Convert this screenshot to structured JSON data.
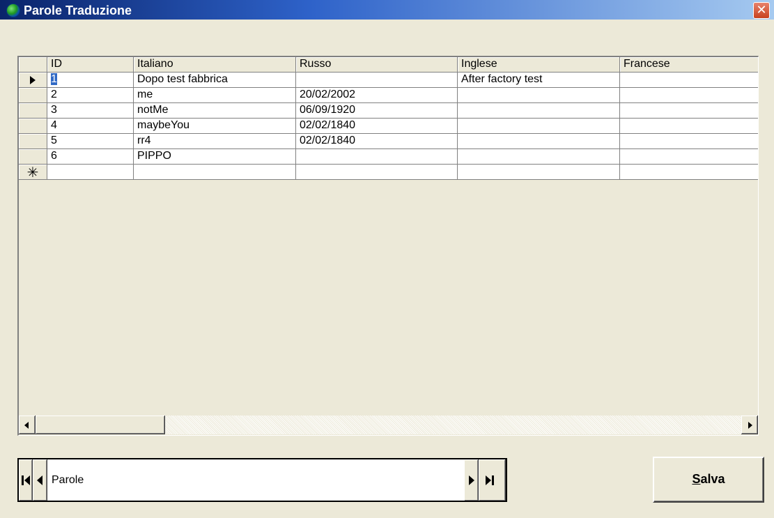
{
  "window": {
    "title": "Parole Traduzione",
    "close_glyph": "✕",
    "icon": "globe-icon"
  },
  "grid": {
    "columns": [
      "ID",
      "Italiano",
      "Russo",
      "Inglese",
      "Francese"
    ],
    "rows": [
      {
        "id": "1",
        "italiano": "Dopo test fabbrica",
        "russo": "",
        "inglese": "After factory test",
        "francese": ""
      },
      {
        "id": "2",
        "italiano": "me",
        "russo": "20/02/2002",
        "inglese": "",
        "francese": ""
      },
      {
        "id": "3",
        "italiano": "notMe",
        "russo": "06/09/1920",
        "inglese": "",
        "francese": ""
      },
      {
        "id": "4",
        "italiano": "maybeYou",
        "russo": "02/02/1840",
        "inglese": "",
        "francese": ""
      },
      {
        "id": "5",
        "italiano": "rr4",
        "russo": "02/02/1840",
        "inglese": "",
        "francese": ""
      },
      {
        "id": "6",
        "italiano": "PIPPO",
        "russo": "",
        "inglese": "",
        "francese": ""
      }
    ],
    "current_row_marker": "row-pointer-icon",
    "new_row_marker": "✳"
  },
  "navigator": {
    "caption": "Parole"
  },
  "buttons": {
    "salva_accel": "S",
    "salva_rest": "alva"
  },
  "colors": {
    "title_bar": "#0A246A",
    "selection": "#316AC5",
    "close_button": "#C8421F",
    "face": "#ECE9D8"
  }
}
